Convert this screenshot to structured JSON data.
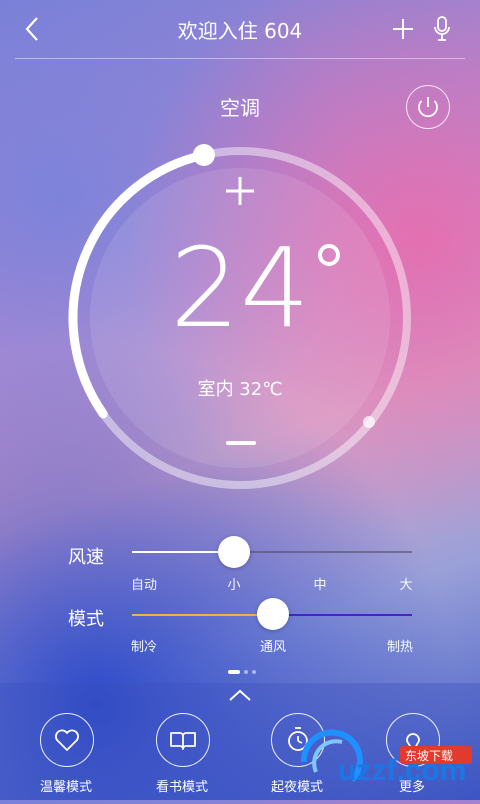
{
  "header": {
    "title": "欢迎入住 604",
    "back_icon": "chevron-left-icon",
    "add_icon": "plus-icon",
    "mic_icon": "microphone-icon"
  },
  "device": {
    "name": "空调",
    "power_icon": "power-icon"
  },
  "dial": {
    "temperature": "24",
    "level": 0.45,
    "indoor": "室内 32℃"
  },
  "fan": {
    "label": "风速",
    "options": [
      "自动",
      "小",
      "中",
      "大"
    ],
    "selected": "小"
  },
  "mode": {
    "label": "模式",
    "options": [
      "制冷",
      "通风",
      "制热"
    ],
    "selected": "通风",
    "colors": {
      "cool": "#e8b73c",
      "heat": "#4a22c8"
    }
  },
  "pager": {
    "pages": 3,
    "current": 1
  },
  "quick": {
    "items": [
      {
        "label": "温馨模式",
        "icon": "heart-icon"
      },
      {
        "label": "看书模式",
        "icon": "book-icon"
      },
      {
        "label": "起夜模式",
        "icon": "clock-icon"
      },
      {
        "label": "更多",
        "icon": "bulb-icon"
      }
    ]
  },
  "watermark": {
    "text": "uzzf.com",
    "subtext": "东坡下载"
  }
}
